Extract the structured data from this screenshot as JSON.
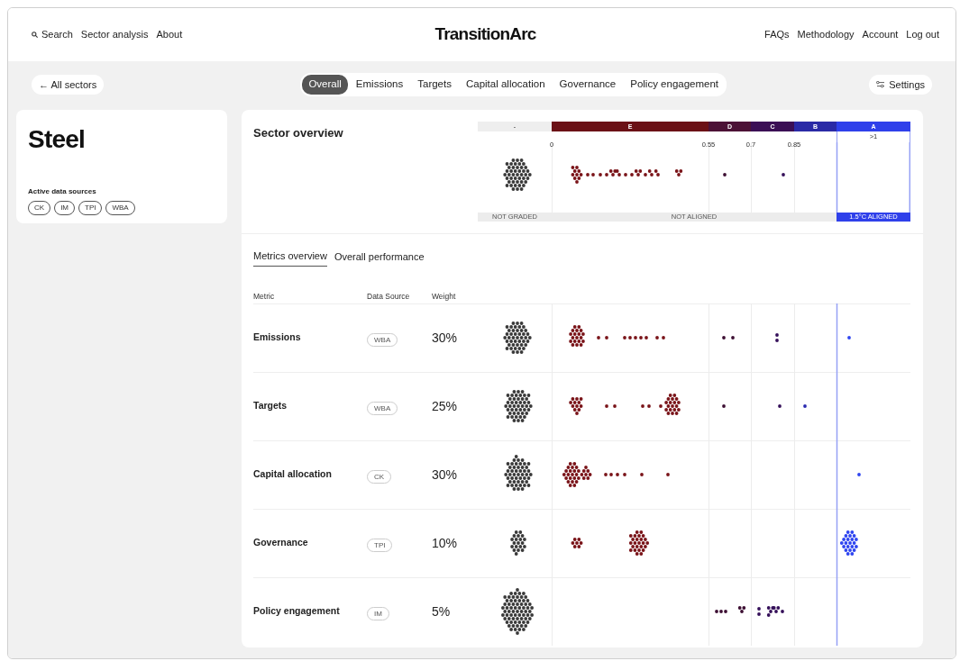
{
  "nav": {
    "left": [
      {
        "label": "Search",
        "kind": "search"
      },
      {
        "label": "Sector analysis",
        "kind": "link"
      },
      {
        "label": "About",
        "kind": "link"
      }
    ],
    "brand": "TransitionArc",
    "right": [
      "FAQs",
      "Methodology",
      "Account",
      "Log out"
    ]
  },
  "back_link": "← All sectors",
  "tabs": [
    {
      "label": "Overall",
      "selected": true
    },
    {
      "label": "Emissions",
      "selected": false
    },
    {
      "label": "Targets",
      "selected": false
    },
    {
      "label": "Capital allocation",
      "selected": false
    },
    {
      "label": "Governance",
      "selected": false
    },
    {
      "label": "Policy engagement",
      "selected": false
    }
  ],
  "settings": "Settings",
  "sector": {
    "title": "Steel",
    "sources_label": "Active data sources",
    "sources": [
      "CK",
      "IM",
      "TPI",
      "WBA"
    ]
  },
  "overview": {
    "title": "Sector overview",
    "grades": [
      {
        "label": "-",
        "color": "#eeeeee"
      },
      {
        "label": "E",
        "color": "#6b1116"
      },
      {
        "label": "D",
        "color": "#4c1236"
      },
      {
        "label": "C",
        "color": "#3b0f55"
      },
      {
        "label": "B",
        "color": "#2a2aa6"
      },
      {
        "label": "A",
        "color": "#2f40ea"
      }
    ],
    "ticks": [
      {
        "label": "0",
        "kind": "edge"
      },
      {
        "label": "0.55",
        "kind": "edge"
      },
      {
        "label": "0.7",
        "kind": "edge"
      },
      {
        "label": "0.85",
        "kind": "edge"
      },
      {
        "label": ">1",
        "kind": "center"
      }
    ],
    "statuses": [
      {
        "label": "NOT GRADED",
        "kind": "not_graded"
      },
      {
        "label": "NOT ALIGNED",
        "kind": "not_aligned"
      },
      {
        "label": "1.5°C ALIGNED",
        "kind": "aligned"
      }
    ]
  },
  "subtabs": [
    {
      "label": "Metrics overview",
      "selected": true
    },
    {
      "label": "Overall performance",
      "selected": false
    }
  ],
  "columns": [
    "Metric",
    "Data Source",
    "Weight"
  ],
  "rows": [
    {
      "metric": "Emissions",
      "source": "WBA",
      "weight": "30%"
    },
    {
      "metric": "Targets",
      "source": "WBA",
      "weight": "25%"
    },
    {
      "metric": "Capital allocation",
      "source": "CK",
      "weight": "30%"
    },
    {
      "metric": "Governance",
      "source": "TPI",
      "weight": "10%"
    },
    {
      "metric": "Policy engagement",
      "source": "IM",
      "weight": "5%"
    }
  ]
}
